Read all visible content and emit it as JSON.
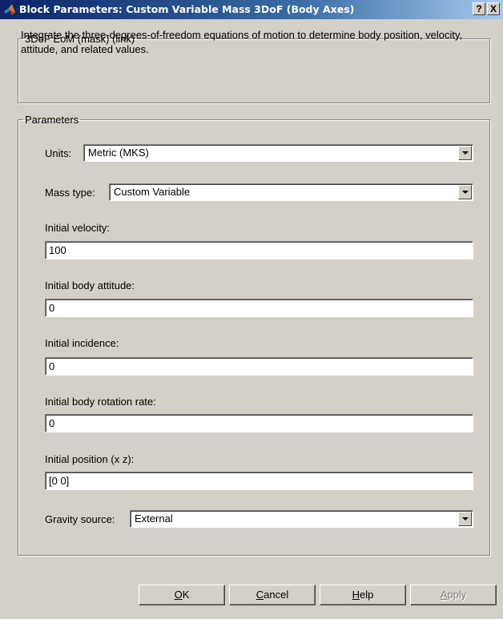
{
  "window": {
    "title": "Block Parameters: Custom Variable Mass 3DoF  (Body Axes)",
    "help_label": "?",
    "close_label": "X",
    "icon": "matlab-logo-icon"
  },
  "mask": {
    "legend": "3DoF EoM (mask) (link)",
    "description": "Integrate the three-degrees-of-freedom equations of motion to determine body position, velocity, attitude, and related values."
  },
  "parameters": {
    "legend": "Parameters",
    "units": {
      "label": "Units:",
      "value": "Metric (MKS)"
    },
    "mass_type": {
      "label": "Mass type:",
      "value": "Custom Variable"
    },
    "initial_velocity": {
      "label": "Initial velocity:",
      "value": "100"
    },
    "initial_body_attitude": {
      "label": "Initial body attitude:",
      "value": "0"
    },
    "initial_incidence": {
      "label": "Initial incidence:",
      "value": "0"
    },
    "initial_body_rotation_rate": {
      "label": "Initial body rotation rate:",
      "value": "0"
    },
    "initial_position": {
      "label": "Initial position (x z):",
      "value": "[0 0]"
    },
    "gravity_source": {
      "label": "Gravity source:",
      "value": "External"
    }
  },
  "buttons": {
    "ok": {
      "mnemonic": "O",
      "rest": "K"
    },
    "cancel": {
      "mnemonic": "C",
      "rest": "ancel"
    },
    "help": {
      "mnemonic": "H",
      "rest": "elp"
    },
    "apply": {
      "mnemonic": "A",
      "rest": "pply"
    }
  }
}
